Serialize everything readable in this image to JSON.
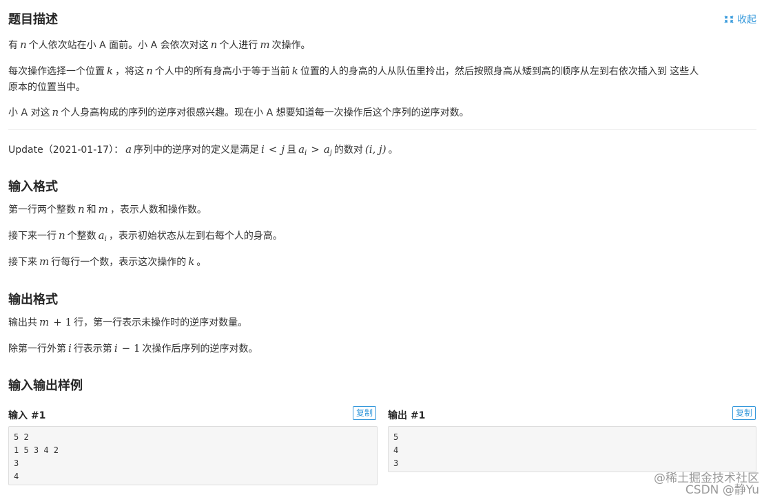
{
  "header": {
    "title": "题目描述",
    "collapse_label": "收起",
    "collapse_icon": "collapse-icon"
  },
  "description": {
    "p1": {
      "a": "有",
      "n": "n",
      "b": "个人依次站在小 A 面前。小 A 会依次对这",
      "n2": "n",
      "c": "个人进行",
      "m": "m",
      "d": "次操作。"
    },
    "p2": {
      "a": "每次操作选择一个位置",
      "k": "k",
      "b": "，将这",
      "n": "n",
      "c": "个人中的所有身高小于等于当前",
      "k2": "k",
      "d": "位置的人的身高的人从队伍里拎出，然后按照身高从矮到高的顺序从左到右依次插入到 这些人",
      "e": "原本的位置当中。"
    },
    "p3": {
      "a": "小 A 对这",
      "n": "n",
      "b": "个人身高构成的序列的逆序对很感兴趣。现在小 A 想要知道每一次操作后这个序列的逆序对数。"
    },
    "update": {
      "a": "Update（2021-01-17）：",
      "arr": "a",
      "b": "序列中的逆序对的定义是满足",
      "i": "i",
      "lt": "<",
      "j": "j",
      "c": "且",
      "ai": "a",
      "ai_sub": "i",
      "gt": ">",
      "aj": "a",
      "aj_sub": "j",
      "d": "的数对",
      "pair": "(i, j)",
      "e": "。"
    }
  },
  "input_format": {
    "title": "输入格式",
    "l1": {
      "a": "第一行两个整数",
      "n": "n",
      "b": "和",
      "m": "m",
      "c": "，表示人数和操作数。"
    },
    "l2": {
      "a": "接下来一行",
      "n": "n",
      "b": "个整数",
      "ai": "a",
      "ai_sub": "i",
      "c": "，表示初始状态从左到右每个人的身高。"
    },
    "l3": {
      "a": "接下来",
      "m": "m",
      "b": "行每行一个数，表示这次操作的",
      "k": "k",
      "c": "。"
    }
  },
  "output_format": {
    "title": "输出格式",
    "l1": {
      "a": "输出共",
      "m": "m",
      "plus": "+ 1",
      "b": "行，第一行表示未操作时的逆序对数量。"
    },
    "l2": {
      "a": "除第一行外第",
      "i": "i",
      "b": "行表示第",
      "i2": "i",
      "minus": "− 1",
      "c": "次操作后序列的逆序对数。"
    }
  },
  "samples": {
    "title": "输入输出样例",
    "input": {
      "label": "输入 #1",
      "copy_label": "复制",
      "lines": [
        "5 2",
        "1 5 3 4 2",
        "3",
        "4"
      ]
    },
    "output": {
      "label": "输出 #1",
      "copy_label": "复制",
      "lines": [
        "5",
        "4",
        "3"
      ]
    }
  },
  "watermark": {
    "line1": "@稀土掘金技术社区",
    "line2": "CSDN @静Yu"
  },
  "colors": {
    "accent": "#3498db",
    "code_bg": "#f6f6f6",
    "text": "#262626"
  }
}
